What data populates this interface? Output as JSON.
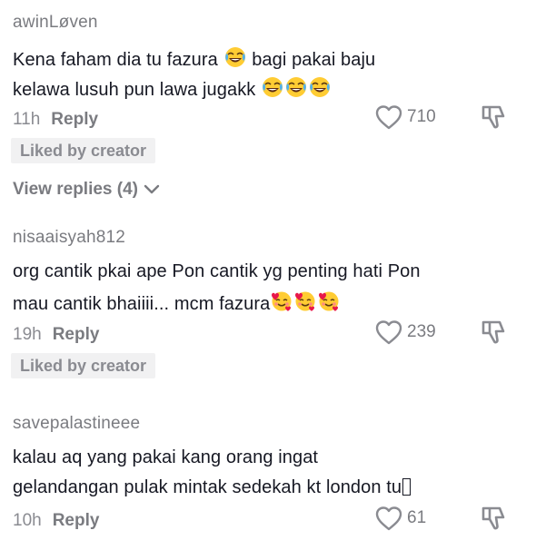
{
  "comments": [
    {
      "username": "awinLøven",
      "line1_before": "Kena faham dia tu fazura ",
      "line1_after": " bagi pakai baju",
      "line2": "kelawa lusuh pun lawa jugakk",
      "time": "11h",
      "reply_label": "Reply",
      "likes": "710",
      "liked_by_creator": "Liked by creator",
      "view_replies": "View replies (4)"
    },
    {
      "username": "nisaaisyah812",
      "line1": "org cantik pkai ape Pon cantik yg penting hati Pon",
      "line2": "mau cantik bhaiiii... mcm fazura",
      "time": "19h",
      "reply_label": "Reply",
      "likes": "239",
      "liked_by_creator": "Liked by creator"
    },
    {
      "username": "savepalastineee",
      "line1": "kalau aq yang pakai kang orang ingat",
      "line2": "gelandangan pulak mintak sedekah kt london tu",
      "time": "10h",
      "reply_label": "Reply",
      "likes": "61"
    }
  ],
  "icons": {
    "like": "heart-outline-icon",
    "dislike": "thumbs-down-icon",
    "expand": "chevron-down-icon",
    "laugh_emoji": "face-with-tears-of-joy",
    "love_emoji": "smiling-face-with-hearts"
  },
  "colors": {
    "username": "#7a7b80",
    "text": "#161823",
    "badge_bg": "#f1f1f2",
    "emoji_yellow": "#ffcc33",
    "heart_red": "#e8174a"
  }
}
